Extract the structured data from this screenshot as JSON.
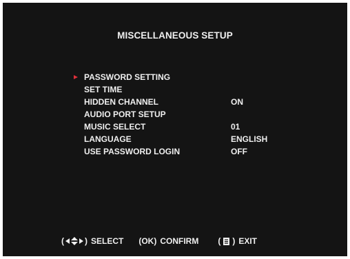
{
  "screen": {
    "title": "MISCELLANEOUS SETUP",
    "background_color": "#141414",
    "text_color": "#efefef",
    "cursor_color": "#e0303a"
  },
  "menu": {
    "items": [
      {
        "label": "PASSWORD SETTING",
        "value": "",
        "selected": true
      },
      {
        "label": "SET TIME",
        "value": "",
        "selected": false
      },
      {
        "label": "HIDDEN CHANNEL",
        "value": "ON",
        "selected": false
      },
      {
        "label": "AUDIO PORT SETUP",
        "value": "",
        "selected": false
      },
      {
        "label": "MUSIC SELECT",
        "value": "01",
        "selected": false
      },
      {
        "label": "LANGUAGE",
        "value": "ENGLISH",
        "selected": false
      },
      {
        "label": "USE PASSWORD LOGIN",
        "value": "OFF",
        "selected": false
      }
    ]
  },
  "footer": {
    "select": {
      "open": "(",
      "close": ")",
      "label": "SELECT",
      "icon": "four-way-arrows-icon"
    },
    "confirm": {
      "key": "(OK)",
      "label": "CONFIRM"
    },
    "exit": {
      "open": "(",
      "close": ")",
      "label": "EXIT",
      "icon": "menu-key-icon"
    }
  }
}
